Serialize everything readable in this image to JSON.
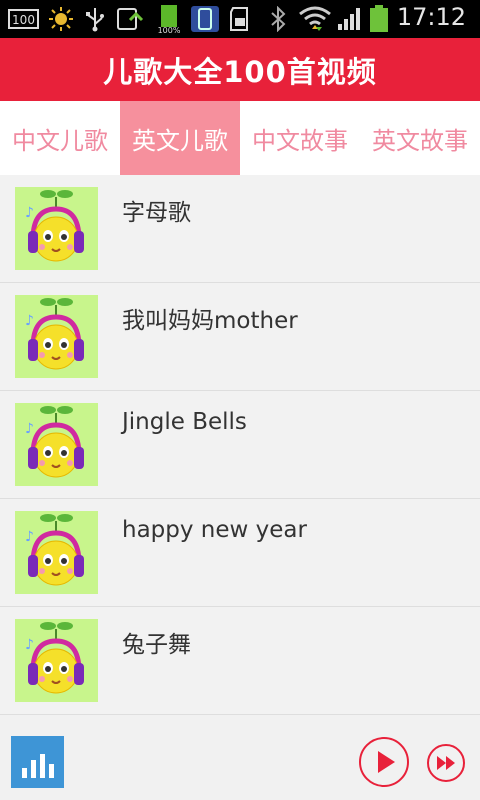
{
  "status_bar": {
    "time": "17:12",
    "icons": [
      "battery-saver-100-icon",
      "sun-icon",
      "usb-icon",
      "sync-icon",
      "battery-full-icon",
      "phone-icon",
      "sd-card-icon",
      "bluetooth-icon",
      "wifi-icon",
      "signal-icon",
      "battery-icon"
    ],
    "badge_100": "100",
    "battery_small_label": "100%"
  },
  "title_bar": {
    "title": "儿歌大全100首视频"
  },
  "tabs": [
    {
      "label": "中文儿歌",
      "active": false
    },
    {
      "label": "英文儿歌",
      "active": true
    },
    {
      "label": "中文故事",
      "active": false
    },
    {
      "label": "英文故事",
      "active": false
    }
  ],
  "list": [
    {
      "title": "字母歌",
      "thumb": "cartoon-headphone-sprout-icon"
    },
    {
      "title": "我叫妈妈mother",
      "thumb": "cartoon-headphone-sprout-icon"
    },
    {
      "title": "Jingle Bells",
      "thumb": "cartoon-headphone-sprout-icon"
    },
    {
      "title": "happy new year",
      "thumb": "cartoon-headphone-sprout-icon"
    },
    {
      "title": "兔子舞",
      "thumb": "cartoon-headphone-sprout-icon"
    }
  ],
  "player": {
    "icons": [
      "equalizer-icon",
      "play-icon",
      "fast-forward-icon"
    ],
    "colors": {
      "accent": "#e8213a",
      "eq": "#3e95d6"
    }
  },
  "colors": {
    "title_bg": "#e8213a",
    "tab_active_bg": "#f6909d",
    "tab_text": "#f08aa0",
    "thumb_bg": "#c8f58c"
  }
}
